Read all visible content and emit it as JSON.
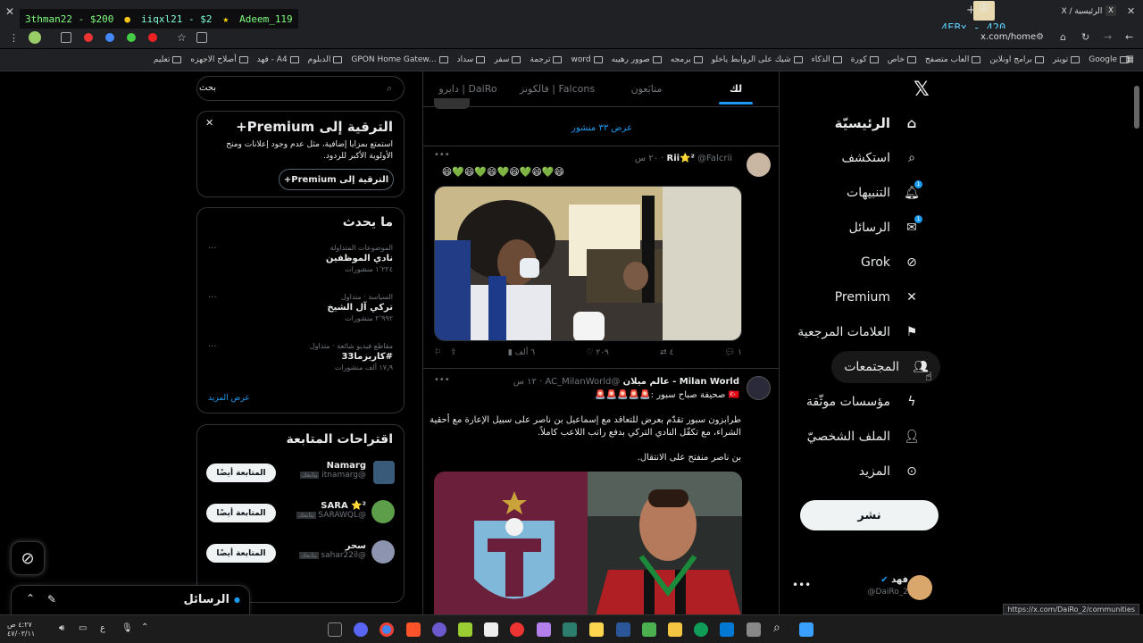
{
  "browser": {
    "tab_title": "(2) الرئيسية / X",
    "url": "x.com/home",
    "status_url": "https://x.com/DaiRo_2/communities",
    "bookmarks": [
      "Google",
      "تويتر",
      "برامج اونلاين",
      "العاب متصفح",
      "خاص",
      "كورة",
      "الذكاء",
      "شيك على الروابط ياخلو",
      "برمجه",
      "صوور رهيبه",
      "word",
      "ترجمة",
      "سفر",
      "سداد",
      "GPON Home Gatew...",
      "الدبلوم",
      "فهد - A4",
      "أصلاح الاجهزه",
      "تعليم"
    ]
  },
  "stream": {
    "donor1": "3thman22 - $200",
    "donor2": "iiqxl21 - $2",
    "donor3": "Adeem_119",
    "counter": "4EBx - 420"
  },
  "nav": {
    "home": "الرئيسيّة",
    "explore": "استكشف",
    "notifications": "التنبيهات",
    "messages": "الرسائل",
    "grok": "Grok",
    "premium": "Premium",
    "bookmarks": "العلامات المرجعية",
    "communities": "المجتمعات",
    "verified_orgs": "مؤسسات موثّقة",
    "profile": "الملف الشخصيّ",
    "more": "المزيد",
    "post": "نشر",
    "notif_badge": "1",
    "msg_badge": "1",
    "user_name": "فهد",
    "user_handle": "@DaiRo_2"
  },
  "feed": {
    "tabs": [
      "لك",
      "متابَعون",
      "فالكونز | Falcons",
      "دايرو | DaiRo"
    ],
    "show_more": "عرض ٣٣ منشور",
    "tweet1": {
      "name": "Rii⭐²",
      "handle": "@Falcrii",
      "time": "٢٠ س",
      "text": "😄💚😄💚😄💚😄💚😄💚😄",
      "replies": "١",
      "reposts": "٤",
      "likes": "٢٠٩",
      "views": "٦ ألف"
    },
    "tweet2": {
      "name": "Milan World - عالم ميلان",
      "handle": "@AC_MilanWorld",
      "time": "١٢ س",
      "line1": "🇹🇷 صحيفة صباح سبور :🚨🚨🚨🚨🚨",
      "line2": "طرابزون سبور تقدّم بعرض للتعاقد مع إسماعيل بن ناصر على سبيل الإعارة مع أحقية الشراء، مع تكفّل النادي التركي بدفع راتب اللاعب كاملاً.",
      "line3": "بن ناصر منفتح على الانتقال."
    }
  },
  "sidebar": {
    "search_placeholder": "بحث",
    "premium": {
      "title": "الترقية إلى Premium+",
      "body": "استمتع بمزايا إضافية، مثل عدم وجود إعلانات ومنح الأولوية الأكبر للردود.",
      "button": "الترقية إلى Premium+"
    },
    "happening": {
      "title": "ما يحدث",
      "trends": [
        {
          "context": "الموضوعات المتداولة",
          "name": "نادي الموظفين",
          "posts": "١٬٢٢٤ منشورات"
        },
        {
          "context": "السياسة · متداول",
          "name": "تركي آل الشيخ",
          "posts": "٢٬٩٩٢ منشورات"
        },
        {
          "context": "مقاطع فيديو شائعة · متداول",
          "name": "#كاريزما33",
          "posts": "١٧٫٩ ألف منشورات"
        }
      ],
      "show_more": "عرض المزيد"
    },
    "who_to_follow": {
      "title": "اقتراحات المتابعة",
      "follow_label": "المتابعة أيضًا",
      "follows_you": "يتابعك",
      "users": [
        {
          "name": "Namarg",
          "handle": "@itnamarg"
        },
        {
          "name": "SARA ⭐²",
          "handle": "@SARAWQL"
        },
        {
          "name": "سحر",
          "handle": "@sahar22il"
        }
      ]
    },
    "messages_dock": "الرسائل"
  },
  "taskbar": {
    "time": "٤:٢٧ ص",
    "date": "٤٧/٠٣/١١",
    "lang": "ع"
  },
  "colors": {
    "accent": "#1d9bf0",
    "bg": "#000000",
    "border": "#2f3336",
    "muted": "#71767b"
  }
}
